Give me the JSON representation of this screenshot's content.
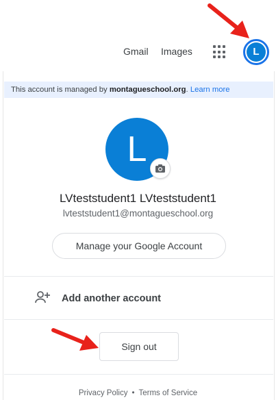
{
  "topbar": {
    "gmail": "Gmail",
    "images": "Images",
    "avatar_letter": "L"
  },
  "managed": {
    "prefix": "This account is managed by ",
    "domain": "montagueschool.org",
    "suffix": ". ",
    "learn_more": "Learn more"
  },
  "account": {
    "avatar_letter": "L",
    "name": "LVteststudent1 LVteststudent1",
    "email": "lvteststudent1@montagueschool.org",
    "manage_label": "Manage your Google Account"
  },
  "actions": {
    "add_account": "Add another account",
    "sign_out": "Sign out"
  },
  "footer": {
    "privacy": "Privacy Policy",
    "separator": "•",
    "terms": "Terms of Service"
  },
  "icons": {
    "apps": "apps-grid-icon",
    "camera": "camera-icon",
    "add_person": "person-add-icon",
    "annotation_arrows": "red-arrow-icon"
  },
  "colors": {
    "accent_blue": "#1a73e8",
    "avatar_blue": "#0a7fd6",
    "managed_bar_bg": "#e8f0fe",
    "arrow_red": "#e8221b"
  }
}
